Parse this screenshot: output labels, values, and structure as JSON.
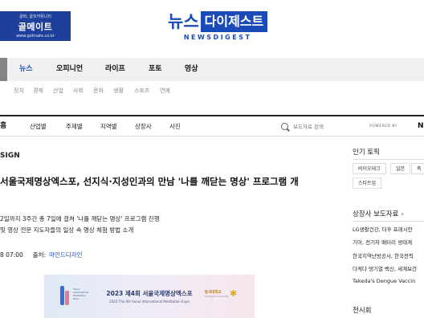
{
  "ad": {
    "tagline": "골퍼, 골프커뮤니티",
    "name": "골메이트",
    "url": "www.golmate.co.kr"
  },
  "logo": {
    "left": "뉴스",
    "right": "다이제스트",
    "sub": "NEWSDIGEST"
  },
  "main_nav": [
    "뉴스",
    "오피니언",
    "라이프",
    "포토",
    "영상"
  ],
  "sub_nav": [
    "정치",
    "경제",
    "산업",
    "사회",
    "문화",
    "생활",
    "스포츠",
    "연예"
  ],
  "section_nav": {
    "home": "홈",
    "items": [
      "산업별",
      "주제별",
      "지역별",
      "상장사",
      "사진"
    ],
    "search_placeholder": "보도자료 검색",
    "powered": "POWERED BY",
    "powered_mark": "N"
  },
  "article": {
    "section": "SIGN",
    "title": "서울국제명상엑스포, 선지식·지성인과의 만남 '나를 깨닫는 명상' 프로그램 개",
    "summary_line1": "2일까지 3주간 총 7일에 걸쳐 '나를 깨닫는 명상' 프로그램 진행",
    "summary_line2": "및 영상 전문 지도자들의 일상 속 명상 체험 방법 소개",
    "time": "8 07:00",
    "source_label": "출처:",
    "source": "마인드디자인"
  },
  "banner": {
    "title": "2023 제4회 서울국제명상엑스포",
    "subtitle": "2023 The 4th Seoul International Meditation Expo",
    "logo_text": "Seoul International Meditation Expo",
    "univ": "동국대학교",
    "univ_sub": "Dongguk University"
  },
  "sidebar": {
    "topics_title": "인기 토픽",
    "tags": [
      "바이오테크",
      "일본",
      "축",
      "스타트업"
    ],
    "press_title": "상장사 보도자료",
    "press_items": [
      "LG생활건강, 더후 프레시안",
      "기아, 전기차 배터리 생태계",
      "한국지역난방공사, 한국전력",
      "다케다 뎅기열 백신, 세계보건",
      "Takeda's Dengue Vaccin"
    ],
    "exhibit_title": "전시회"
  },
  "colors": {
    "brand_blue": "#1a49b8",
    "ad_blue": "#1e3f9a",
    "nav_bg": "#f0f0f0"
  }
}
